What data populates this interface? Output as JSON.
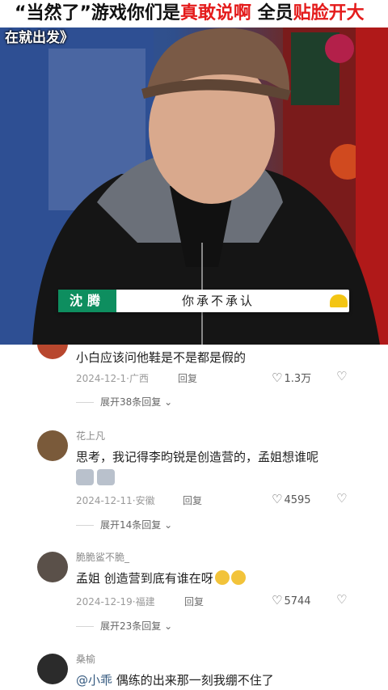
{
  "video": {
    "banner_parts": [
      {
        "text": "“当然了”游戏你们是",
        "highlight": false
      },
      {
        "text": "真敢说啊",
        "highlight": true
      },
      {
        "text": " 全员",
        "highlight": false
      },
      {
        "text": "贴脸开大",
        "highlight": true
      }
    ],
    "subtitle": "在就出发》",
    "speaker_name": "沈腾",
    "caption": "你承不承认"
  },
  "comments": [
    {
      "author": "",
      "text": "小白应该问他鞋是不是都是假的",
      "date": "2024-12-1",
      "location": "广西",
      "reply_label": "回复",
      "likes": "1.3万",
      "expand_label": "展开38条回复"
    },
    {
      "author": "花上凡",
      "text": "思考，我记得李昀锐是创造营的，孟姐想谁呢",
      "date": "2024-12-11",
      "location": "安徽",
      "reply_label": "回复",
      "likes": "4595",
      "expand_label": "展开14条回复"
    },
    {
      "author": "脆脆鲨不脆_",
      "text": "孟姐 创造营到底有谁在呀",
      "date": "2024-12-19",
      "location": "福建",
      "reply_label": "回复",
      "likes": "5744",
      "expand_label": "展开23条回复"
    },
    {
      "author": "桑榆",
      "mention": "@小乖",
      "text": " 偶练的出来那一刻我绷不住了"
    }
  ],
  "icons": {
    "heart": "♡",
    "dislike": "♡",
    "chevron": "⌄"
  },
  "colors": {
    "highlight_red": "#e41b1b",
    "name_tag_green": "#0e8e5f",
    "mention_blue": "#34597f"
  }
}
